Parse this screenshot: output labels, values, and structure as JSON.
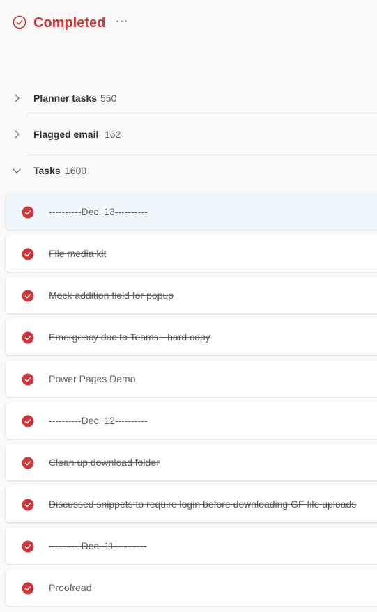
{
  "header": {
    "title": "Completed",
    "icon": "check-circle-icon",
    "more_label": "···",
    "accent_color": "#d13438"
  },
  "groups": [
    {
      "label": "Planner tasks",
      "count": "550",
      "expanded": false
    },
    {
      "label": "Flagged email",
      "count": "162",
      "expanded": false
    },
    {
      "label": "Tasks",
      "count": "1600",
      "expanded": true
    }
  ],
  "tasks": [
    {
      "title": "----------Dec. 13----------",
      "completed": true,
      "selected": true
    },
    {
      "title": "File media kit",
      "completed": true,
      "selected": false
    },
    {
      "title": "Mock addition field for popup",
      "completed": true,
      "selected": false
    },
    {
      "title": "Emergency doc to Teams - hard copy",
      "completed": true,
      "selected": false
    },
    {
      "title": "Power Pages Demo",
      "completed": true,
      "selected": false
    },
    {
      "title": "----------Dec. 12----------",
      "completed": true,
      "selected": false
    },
    {
      "title": "Clean up download folder",
      "completed": true,
      "selected": false
    },
    {
      "title": "Discussed snippets to require login before downloading GF file uploads",
      "completed": true,
      "selected": false
    },
    {
      "title": "----------Dec. 11----------",
      "completed": true,
      "selected": false
    },
    {
      "title": "Proofread",
      "completed": true,
      "selected": false
    }
  ]
}
